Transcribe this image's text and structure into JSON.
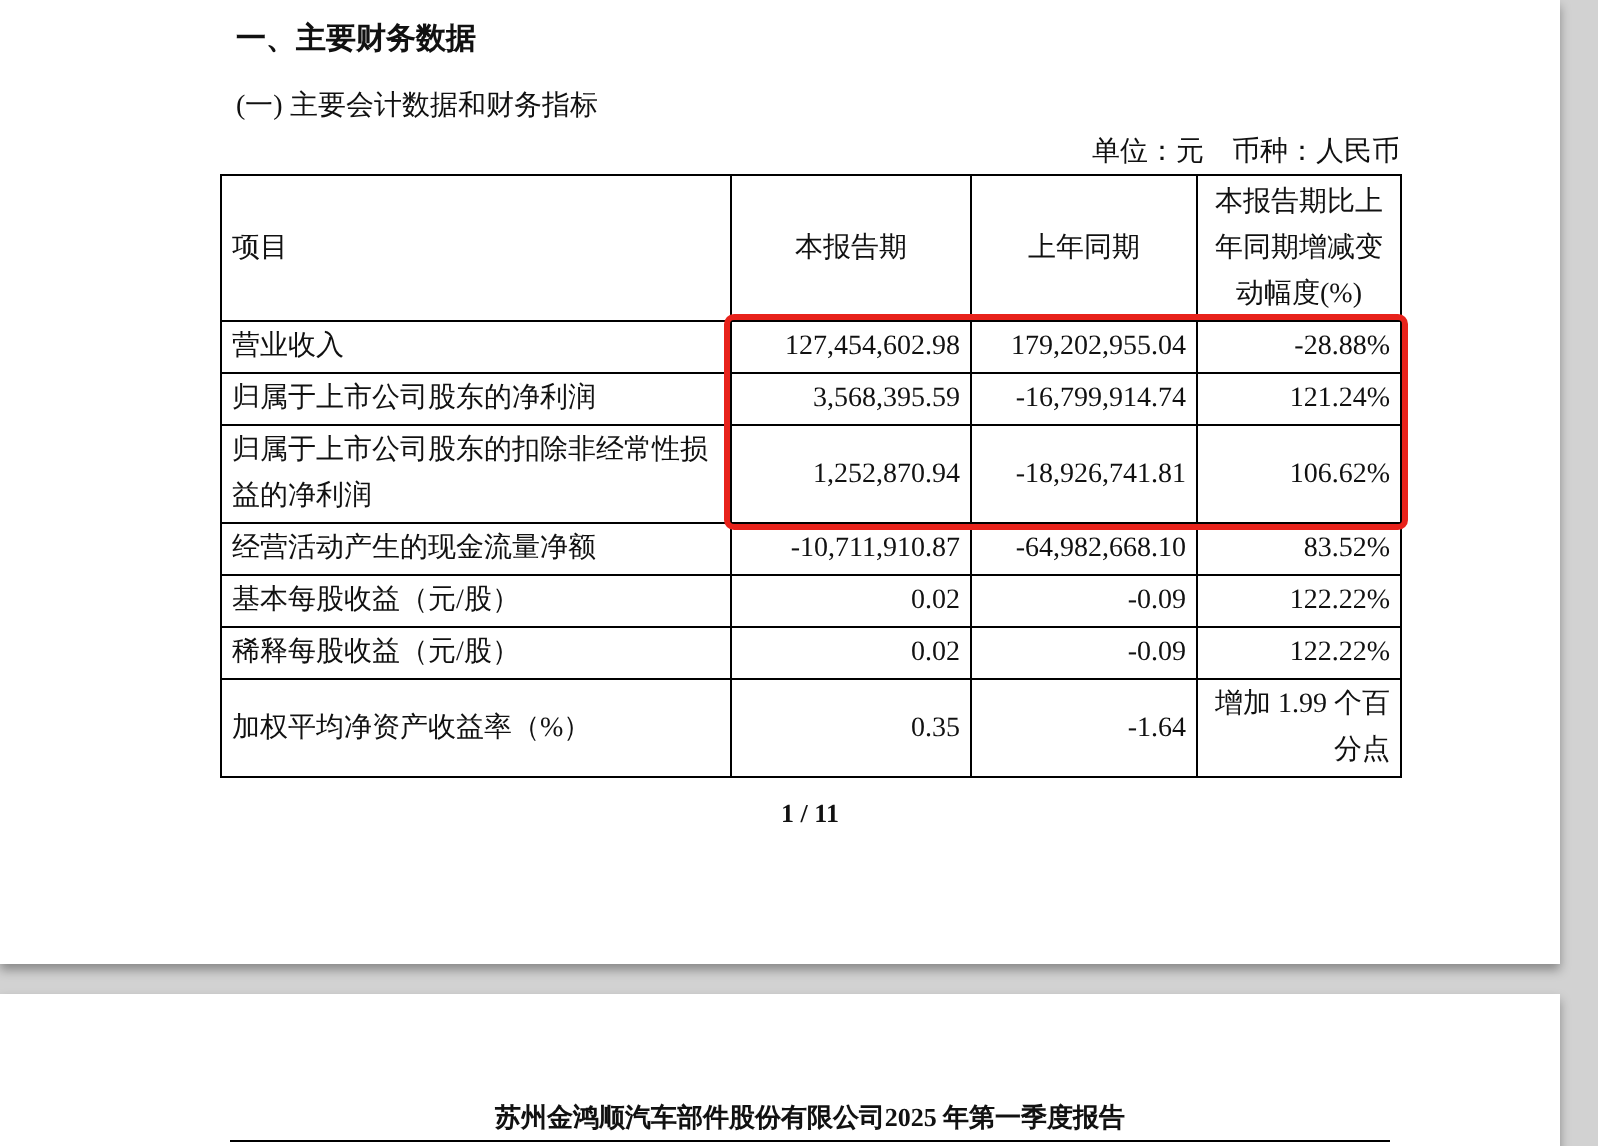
{
  "section_title": "一、主要财务数据",
  "subsection_title": "(一) 主要会计数据和财务指标",
  "unit_note": {
    "unit": "单位：元",
    "currency": "币种：人民币"
  },
  "table": {
    "columns": [
      "项目",
      "本报告期",
      "上年同期",
      "本报告期比上年同期增减变动幅度(%)"
    ],
    "rows": [
      {
        "cells": [
          "营业收入",
          "127,454,602.98",
          "179,202,955.04",
          "-28.88%"
        ],
        "highlighted": true
      },
      {
        "cells": [
          "归属于上市公司股东的净利润",
          "3,568,395.59",
          "-16,799,914.74",
          "121.24%"
        ],
        "highlighted": true
      },
      {
        "cells": [
          "归属于上市公司股东的扣除非经常性损益的净利润",
          "1,252,870.94",
          "-18,926,741.81",
          "106.62%"
        ],
        "highlighted": true
      },
      {
        "cells": [
          "经营活动产生的现金流量净额",
          "-10,711,910.87",
          "-64,982,668.10",
          "83.52%"
        ],
        "highlighted": false
      },
      {
        "cells": [
          "基本每股收益（元/股）",
          "0.02",
          "-0.09",
          "122.22%"
        ],
        "highlighted": false
      },
      {
        "cells": [
          "稀释每股收益（元/股）",
          "0.02",
          "-0.09",
          "122.22%"
        ],
        "highlighted": false
      },
      {
        "cells": [
          "加权平均净资产收益率（%）",
          "0.35",
          "-1.64",
          "增加 1.99 个百分点"
        ],
        "highlighted": false
      }
    ]
  },
  "page_number": "1 / 11",
  "next_page_header": "苏州金鸿顺汽车部件股份有限公司2025 年第一季度报告"
}
